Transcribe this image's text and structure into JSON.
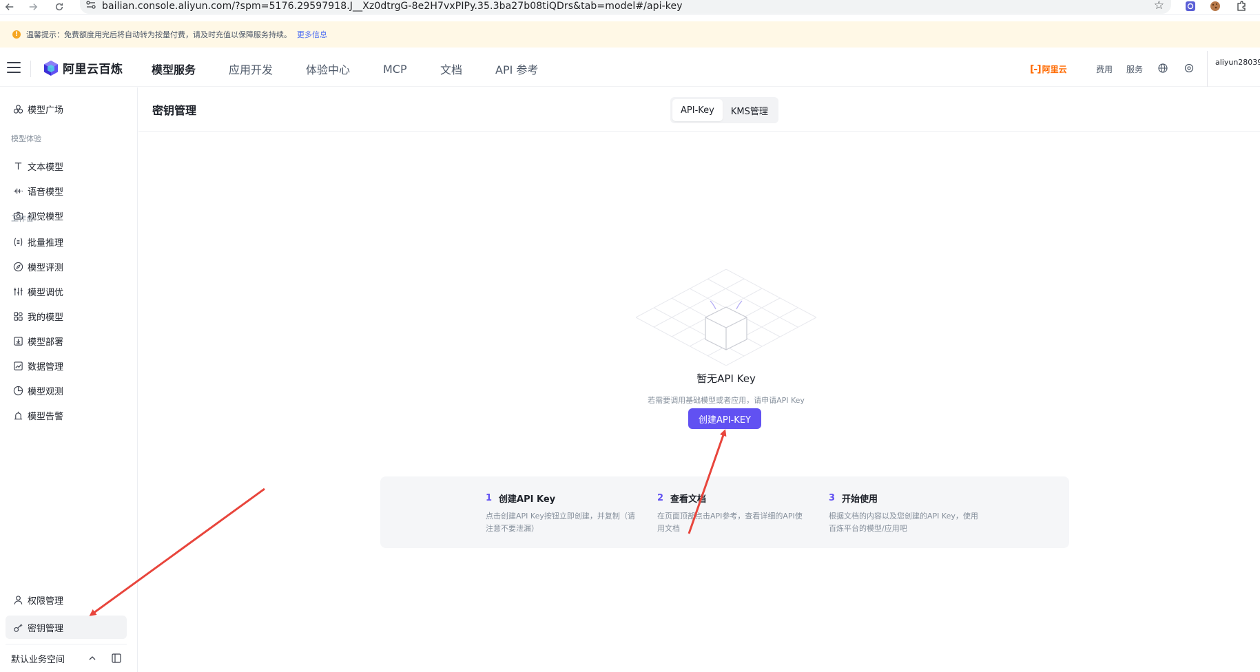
{
  "browser": {
    "url": "bailian.console.aliyun.com/?spm=5176.29597918.J__Xz0dtrgG-8e2H7vxPIPy.35.3ba27b08tiQDrs&tab=model#/api-key"
  },
  "notice": {
    "text": "温馨提示：免费额度用完后将自动转为按量付费，请及时充值以保障服务持续。",
    "link": "更多信息"
  },
  "topnav": {
    "logo": "阿里云百炼",
    "menu": [
      "模型服务",
      "应用开发",
      "体验中心",
      "MCP",
      "文档",
      "API 参考"
    ],
    "aliyun_logo": "阿里云",
    "links": [
      "费用",
      "服务"
    ],
    "username": "aliyun28039",
    "brand_color": "#ff6a00"
  },
  "sidebar": {
    "top_item": "模型广场",
    "group1_label": "模型体验",
    "group1_items": [
      "文本模型",
      "语音模型",
      "视觉模型"
    ],
    "group2_label": "工作台",
    "group2_items": [
      "批量推理",
      "模型评测",
      "模型调优",
      "我的模型",
      "模型部署",
      "数据管理",
      "模型观测",
      "模型告警"
    ],
    "bottom_items": [
      "权限管理",
      "密钥管理"
    ],
    "selected": "密钥管理",
    "workspace": "默认业务空间"
  },
  "main": {
    "title": "密钥管理",
    "tabs": [
      "API-Key",
      "KMS管理"
    ],
    "active_tab": "API-Key",
    "empty_title": "暂无API Key",
    "empty_desc": "若需要调用基础模型或者应用，请申请API Key",
    "create_button": "创建API-KEY",
    "accent_color": "#6151f2",
    "steps": [
      {
        "num": "1",
        "title": "创建API Key",
        "desc": "点击创建API Key按钮立即创建，并复制（请注意不要泄漏）"
      },
      {
        "num": "2",
        "title": "查看文档",
        "desc": "在页面顶部点击API参考，查看详细的API使用文档"
      },
      {
        "num": "3",
        "title": "开始使用",
        "desc": "根据文档的内容以及您创建的API Key，使用百炼平台的模型/应用吧"
      }
    ]
  },
  "annotation_color": "#e8453c"
}
